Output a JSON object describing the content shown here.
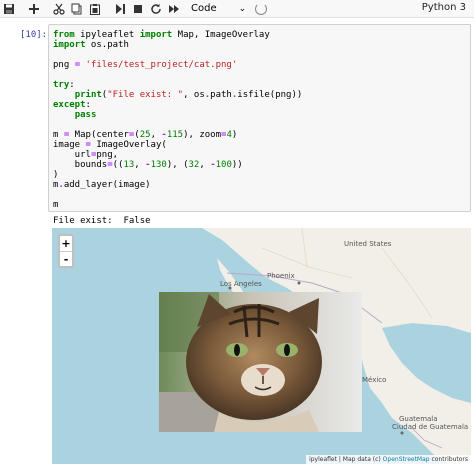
{
  "toolbar": {
    "buttons": [
      {
        "name": "save-icon"
      },
      {
        "name": "add-cell-icon"
      },
      {
        "name": "cut-icon"
      },
      {
        "name": "copy-icon"
      },
      {
        "name": "paste-icon"
      },
      {
        "name": "run-icon"
      },
      {
        "name": "stop-icon"
      },
      {
        "name": "restart-icon"
      },
      {
        "name": "restart-run-all-icon"
      }
    ],
    "cell_type": "Code",
    "kernel": "Python 3"
  },
  "cell": {
    "prompt": "[10]:",
    "code_lines": [
      "from ipyleaflet import Map, ImageOverlay",
      "import os.path",
      "",
      "png = 'files/test_project/cat.png'",
      "",
      "try:",
      "    print(\"File exist: \", os.path.isfile(png))",
      "except:",
      "    pass",
      "",
      "m = Map(center=(25, -115), zoom=4)",
      "image = ImageOverlay(",
      "    url=png,",
      "    bounds=((13, -130), (32, -100))",
      ")",
      "m.add_layer(image)",
      "",
      "m"
    ],
    "output": "File exist:  False"
  },
  "map": {
    "zoom_in": "+",
    "zoom_out": "-",
    "labels": {
      "united_states": "United States",
      "phoenix": "Phoenix",
      "los_angeles": "Los Angeles",
      "mexico": "México",
      "guatemala": "Guatemala",
      "city_guatemala": "Ciudad de Guatemala"
    },
    "attribution": {
      "prefix": "ipyleaflet | Map data (c) ",
      "link": "OpenStreetMap",
      "suffix": " contributors"
    },
    "colors": {
      "water": "#aad3df",
      "land": "#f2efe9",
      "border": "#b7a9c8"
    }
  }
}
